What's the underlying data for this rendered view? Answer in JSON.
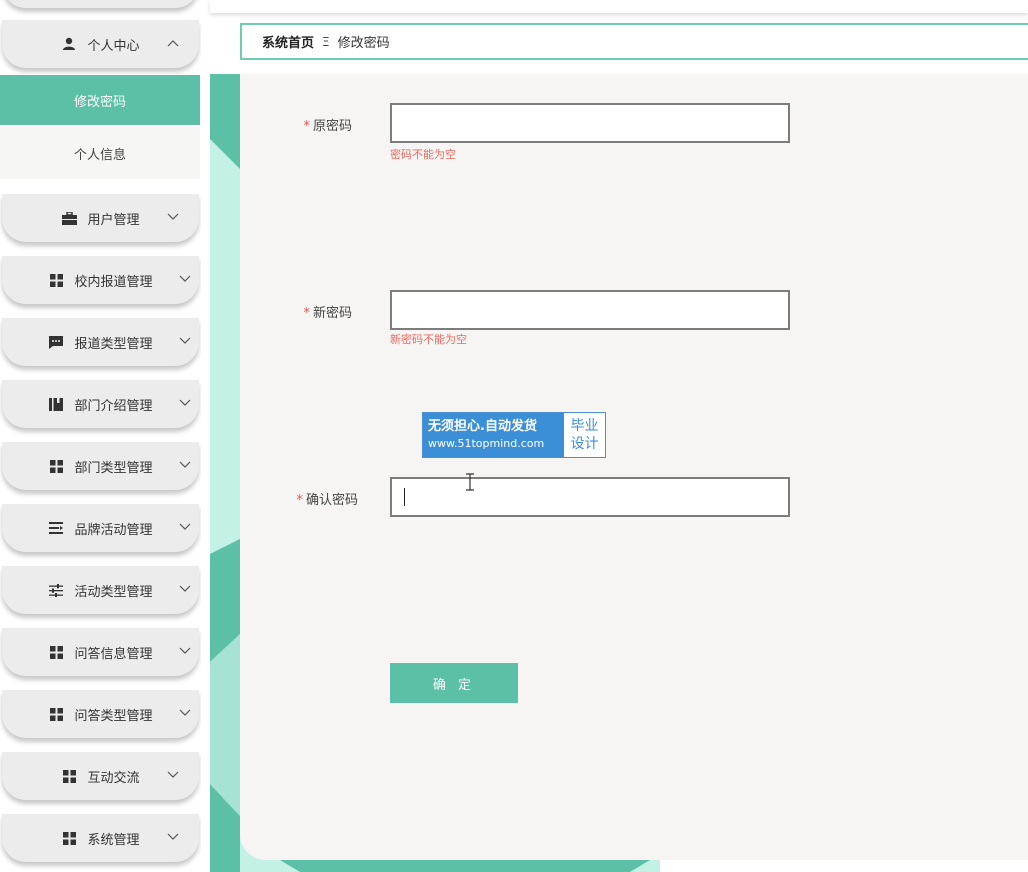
{
  "sidebar": {
    "personal_center": "个人中心",
    "sub_active": "修改密码",
    "sub_item": "个人信息",
    "menus": [
      {
        "label": "用户管理",
        "icon": "briefcase-icon"
      },
      {
        "label": "校内报道管理",
        "icon": "grid-icon"
      },
      {
        "label": "报道类型管理",
        "icon": "message-icon"
      },
      {
        "label": "部门介绍管理",
        "icon": "book-icon"
      },
      {
        "label": "部门类型管理",
        "icon": "grid-icon"
      },
      {
        "label": "品牌活动管理",
        "icon": "list-icon"
      },
      {
        "label": "活动类型管理",
        "icon": "sliders-icon"
      },
      {
        "label": "问答信息管理",
        "icon": "grid-icon"
      },
      {
        "label": "问答类型管理",
        "icon": "grid-icon"
      },
      {
        "label": "互动交流",
        "icon": "grid-icon"
      },
      {
        "label": "系统管理",
        "icon": "grid-icon"
      }
    ]
  },
  "breadcrumb": {
    "home": "系统首页",
    "separator": "Ξ",
    "current": "修改密码"
  },
  "form": {
    "old_password": {
      "label": "原密码",
      "value": "",
      "error": "密码不能为空"
    },
    "new_password": {
      "label": "新密码",
      "value": "",
      "error": "新密码不能为空"
    },
    "confirm_password": {
      "label": "确认密码",
      "value": ""
    },
    "required_mark": "*",
    "submit": "确 定"
  },
  "watermark": {
    "line1": "无须担心.自动发货",
    "line2": "www.51topmind.com",
    "right1": "毕业",
    "right2": "设计"
  },
  "colors": {
    "accent": "#5cc0a6",
    "error": "#ea6b60",
    "background_mint": "#c7f3e8"
  }
}
